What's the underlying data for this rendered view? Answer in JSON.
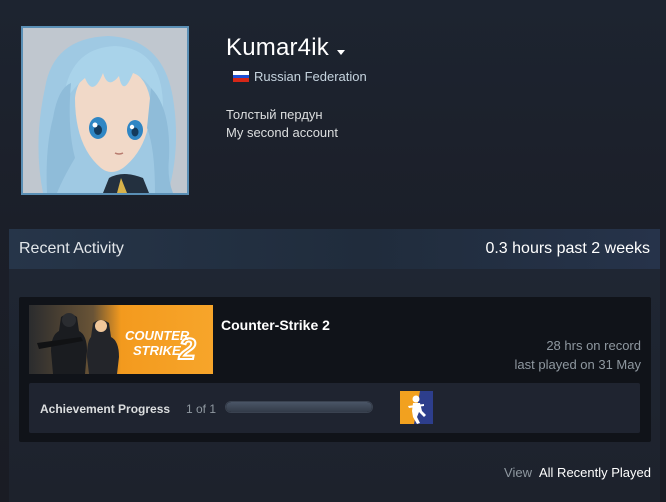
{
  "profile": {
    "persona_name": "Kumar4ik",
    "country": "Russian Federation",
    "summary_line_1": "Толстый пердун",
    "summary_line_2": "My second account",
    "flag_colors": [
      "#ffffff",
      "#1f4fd6",
      "#d62718"
    ]
  },
  "recent_activity": {
    "title": "Recent Activity",
    "hours_label": "0.3 hours past 2 weeks",
    "game": {
      "name": "Counter-Strike 2",
      "hours_on_record": "28 hrs on record",
      "last_played": "last played on 31 May",
      "capsule_title_line_1": "COUNTER",
      "capsule_title_line_2": "STRIKE",
      "capsule_number": "2",
      "achievements": {
        "label": "Achievement Progress",
        "count": "1 of 1",
        "progress": 1.0
      }
    },
    "view_prefix": "View",
    "view_link": "All Recently Played"
  },
  "colors": {
    "accent_orange": "#f39a1e",
    "achievement_bg": "#2d3e8c",
    "avatar_border": "#5a8fb5"
  },
  "icons": {
    "avatar": "anime-avatar-image",
    "achievement": "counter-terrorist-icon"
  }
}
